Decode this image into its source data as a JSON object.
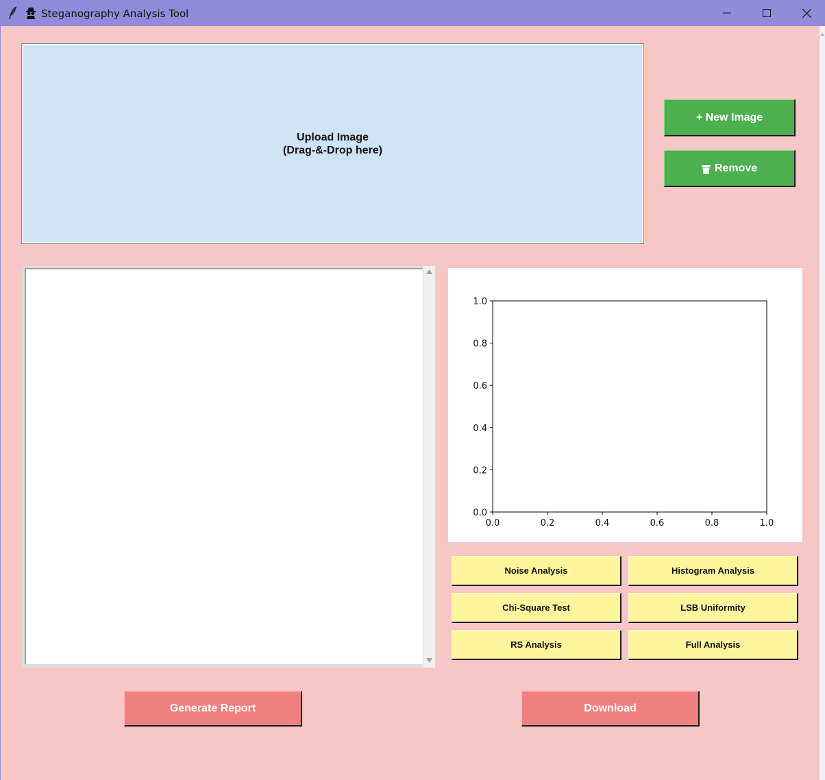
{
  "window": {
    "title": "Steganography Analysis Tool",
    "app_icon": "feather-icon",
    "title_icon": "spy-icon",
    "controls": [
      "minimize-icon",
      "maximize-icon",
      "close-icon"
    ],
    "titlebar_color": "#8f8cd9",
    "background_color": "#f7c6c6"
  },
  "dropzone": {
    "line1": "Upload Image",
    "line2": "(Drag-&-Drop here)",
    "color": "#cfe3f5"
  },
  "side_buttons": {
    "new_image": "+ New Image",
    "remove": "Remove",
    "remove_icon": "trash-icon",
    "color": "#4caf50"
  },
  "analysis_buttons": {
    "noise": "Noise Analysis",
    "histogram": "Histogram Analysis",
    "chi_square": "Chi-Square Test",
    "lsb": "LSB Uniformity",
    "rs": "RS Analysis",
    "full": "Full Analysis",
    "color": "#fff59d"
  },
  "bottom_buttons": {
    "generate_report": "Generate Report",
    "download": "Download",
    "color": "#f08080"
  },
  "results_text": "",
  "chart_data": {
    "type": "line",
    "series": [],
    "xlim": [
      0.0,
      1.0
    ],
    "ylim": [
      0.0,
      1.0
    ],
    "xticks": [
      "0.0",
      "0.2",
      "0.4",
      "0.6",
      "0.8",
      "1.0"
    ],
    "yticks": [
      "0.0",
      "0.2",
      "0.4",
      "0.6",
      "0.8",
      "1.0"
    ],
    "title": "",
    "xlabel": "",
    "ylabel": "",
    "grid": false
  }
}
